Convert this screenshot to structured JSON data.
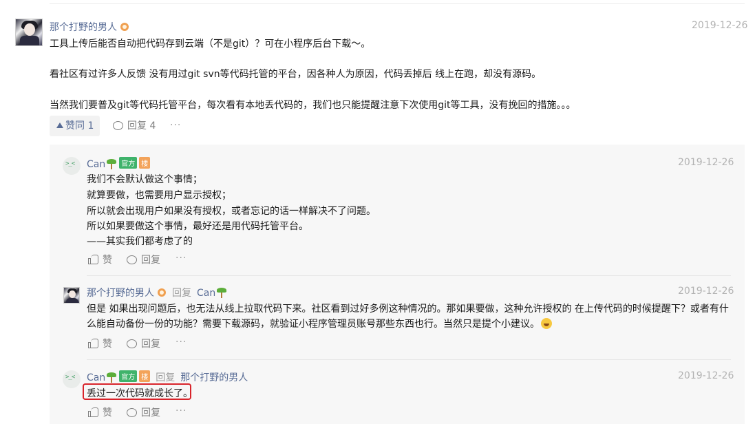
{
  "post": {
    "author": "那个打野的男人",
    "date": "2019-12-26",
    "lines": [
      "工具上传后能否自动把代码存到云端（不是git）？可在小程序后台下载～。",
      "看社区有过许多人反馈 没有用过git svn等代码托管的平台，因各种人为原因，代码丢掉后 线上在跑，却没有源码。",
      "当然我们要普及git等代码托管平台，每次看有本地丢代码的，我们也只能提醒注意下次使用git等工具，没有挽回的措施。。。"
    ],
    "like_label": "赞同 1",
    "reply_label": "回复 4",
    "more": "···"
  },
  "replies": [
    {
      "author": "Can",
      "tag_official": "官方",
      "tag_floor": "楼",
      "date": "2019-12-26",
      "lines": [
        "我们不会默认做这个事情；",
        "就算要做，也需要用户显示授权；",
        "所以就会出现用户如果没有授权，或者忘记的话一样解决不了问题。",
        "所以如果要做这个事情，最好还是用代码托管平台。",
        "——其实我们都考虑了的"
      ],
      "like": "赞",
      "reply": "回复",
      "more": "···"
    },
    {
      "author": "那个打野的男人",
      "reply_word": "回复",
      "reply_to": "Can",
      "date": "2019-12-26",
      "lines": [
        "但是 如果出现问题后，也无法从线上拉取代码下来。社区看到过好多例这种情况的。那如果要做，这种允许授权的 在上传代码的时候提醒下？或者有什",
        "么能自动备份一份的功能？需要下载源码，就验证小程序管理员账号那些东西也行。当然只是提个小建议。"
      ],
      "emoji": "laughing-emoji",
      "like": "赞",
      "reply": "回复",
      "more": "···"
    },
    {
      "author": "Can",
      "tag_official": "官方",
      "tag_floor": "楼",
      "reply_word": "回复",
      "reply_to": "那个打野的男人",
      "date": "2019-12-26",
      "lines": [
        "丢过一次代码就成长了。"
      ],
      "like": "赞",
      "reply": "回复",
      "more": "···"
    }
  ],
  "colors": {
    "link": "#576b95",
    "official_tag": "#3fb36b",
    "floor_tag": "#f3a35a",
    "highlight": "#d8232a"
  }
}
